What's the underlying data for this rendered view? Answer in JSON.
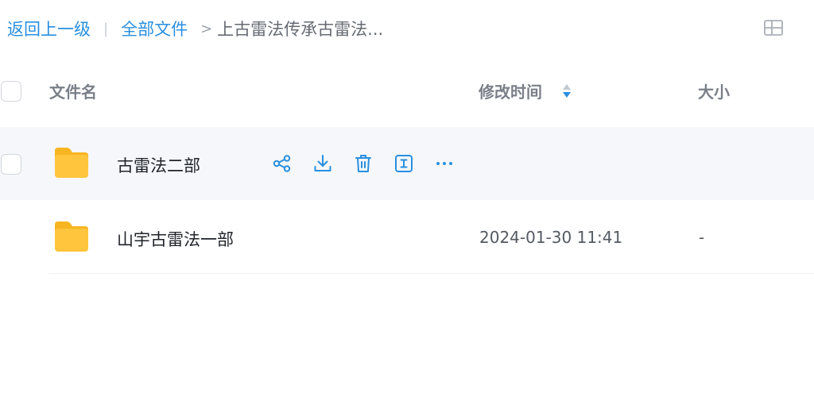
{
  "breadcrumb": {
    "back": "返回上一级",
    "separator": "|",
    "all_files": "全部文件",
    "arrow": ">",
    "current": "上古雷法传承古雷法..."
  },
  "table": {
    "columns": {
      "name": "文件名",
      "modified": "修改时间",
      "size": "大小"
    },
    "rows": [
      {
        "name": "古雷法二部",
        "modified": "",
        "size": ""
      },
      {
        "name": "山宇古雷法一部",
        "modified": "2024-01-30 11:41",
        "size": "-"
      }
    ]
  },
  "icons": {
    "view_toggle": "grid-view-icon",
    "sort": "sort-icon",
    "folder": "folder-icon",
    "share": "share-icon",
    "download": "download-icon",
    "delete": "trash-icon",
    "rename": "rename-icon",
    "more": "more-icon"
  },
  "colors": {
    "accent": "#2a8fe0",
    "folder": "#ffc53d",
    "row_hover": "#f5f7fa",
    "text": "#1f2329",
    "header_text": "#7a7f88"
  }
}
